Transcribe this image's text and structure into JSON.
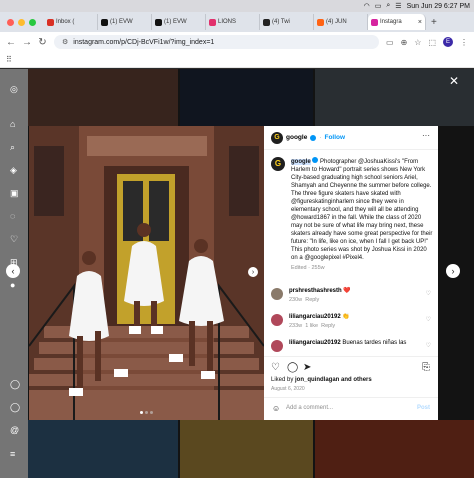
{
  "menubar": {
    "datetime": "Sun Jun 29  6:27 PM"
  },
  "tabs": [
    {
      "label": "Inbox (",
      "color": "#d93025"
    },
    {
      "label": "(1) EVW",
      "color": "#111111"
    },
    {
      "label": "(1) EVW",
      "color": "#111111"
    },
    {
      "label": "LIONS",
      "color": "#e1306c"
    },
    {
      "label": "(4) Twi",
      "color": "#222222"
    },
    {
      "label": "(4) JUN",
      "color": "#ff6314"
    },
    {
      "label": "Instagra",
      "color": "#d6249f"
    }
  ],
  "toolbar": {
    "url": "instagram.com/p/CDj-BcVFi1w/?img_index=1",
    "profile_initial": "E"
  },
  "post": {
    "username": "google",
    "follow_label": "Follow",
    "caption_user": "google",
    "caption_text": "Photographer @JoshuaKissi's \"From Harlem to Howard\" portrait series shows New York City-based graduating high school seniors Ariel, Shamyah and Cheyenne the summer before college. The three figure skaters have skated with @figureskatinginharlem since they were in elementary school, and they will all be attending @howard1867 in the fall. While the class of 2020 may not be sure of what life may bring next, these skaters already have some great perspective for their future: \"In life, like on ice, when I fall I get back UP!\" This photo series was shot by Joshua Kissi in 2020 on a @googlepixel #Pixel4.",
    "edited": "Edited · 255w",
    "comments": [
      {
        "user": "prshresthashresth",
        "text": "❤️",
        "age": "230w",
        "likes": "",
        "reply": "Reply",
        "avatar_color": "#8a7a6a"
      },
      {
        "user": "liliangarciau20192",
        "text": "👏",
        "age": "233w",
        "likes": "1 like",
        "reply": "Reply",
        "avatar_color": "#b0485a"
      },
      {
        "user": "liliangarciau20192",
        "text": "Buenas tardes niñas las",
        "age": "",
        "likes": "",
        "reply": "",
        "avatar_color": "#b0485a"
      }
    ],
    "liked_by_prefix": "Liked by ",
    "liked_by_user": "jon_quindlagan",
    "liked_by_suffix": " and others",
    "date": "August 6, 2020",
    "add_comment_placeholder": "Add a comment...",
    "post_label": "Post"
  },
  "colors": {
    "accent": "#0095f6",
    "panel": "#ffffff",
    "backdrop": "#000000"
  }
}
